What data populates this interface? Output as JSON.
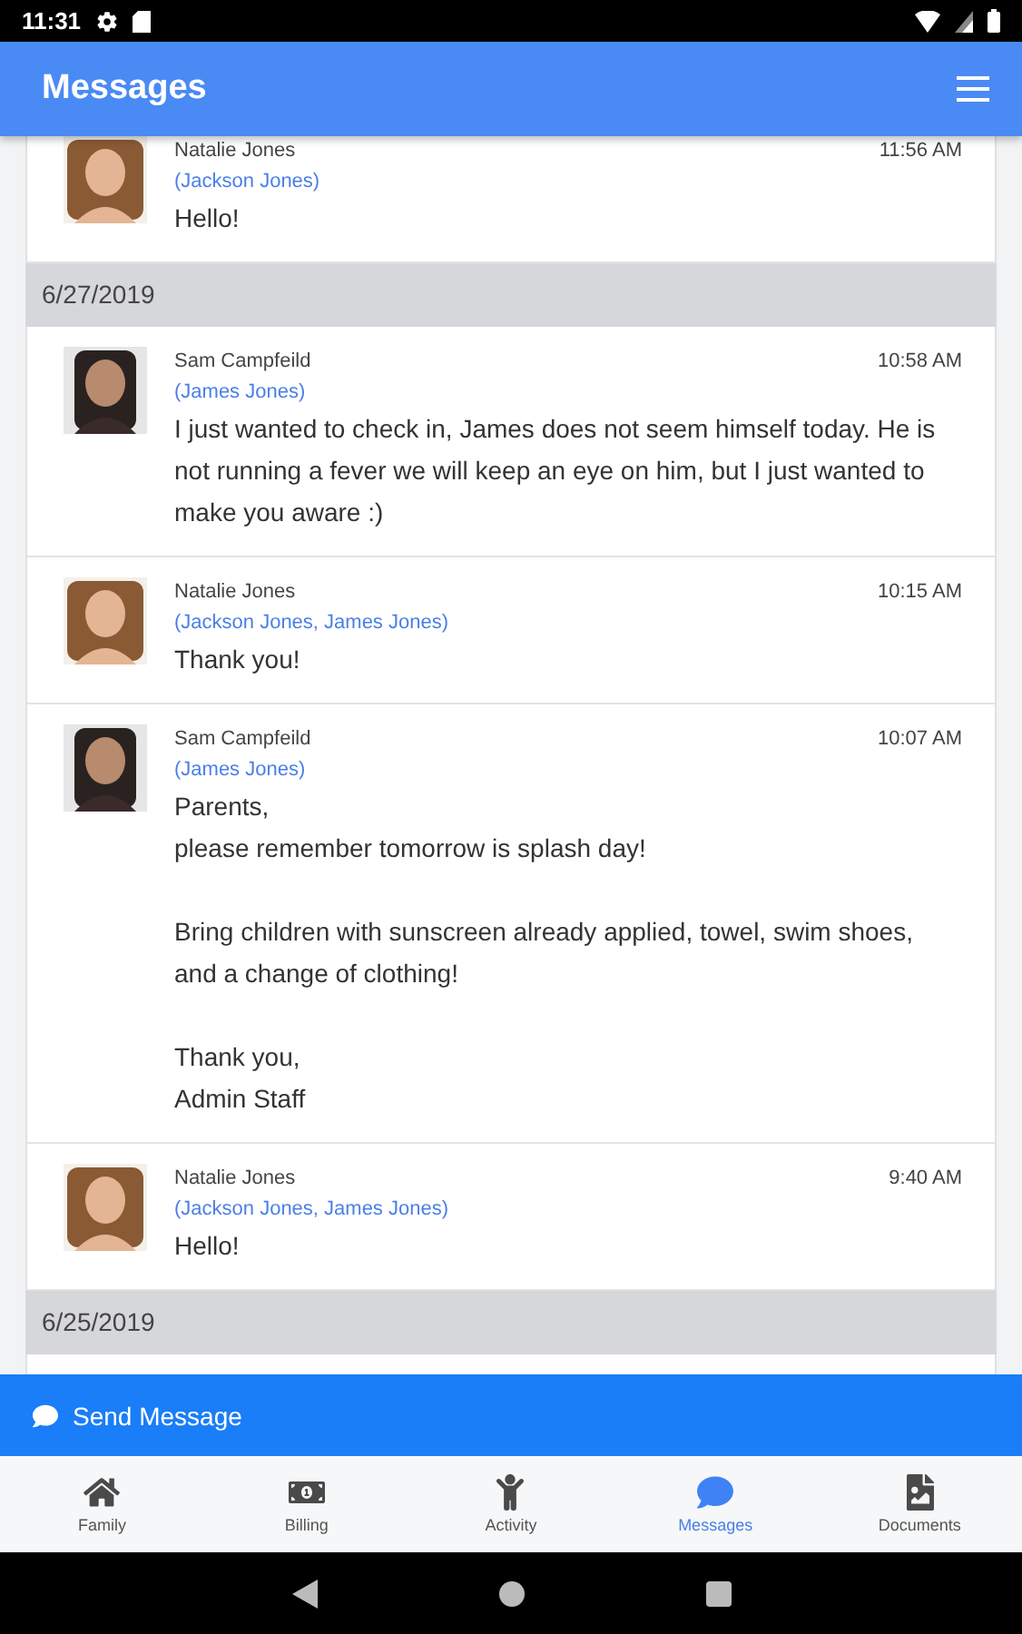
{
  "status_bar": {
    "time": "11:31"
  },
  "header": {
    "title": "Messages"
  },
  "feed": [
    {
      "kind": "message",
      "sender": "Natalie Jones",
      "recipients": "(Jackson Jones)",
      "time": "11:56 AM",
      "body": "Hello!"
    },
    {
      "kind": "date",
      "label": "6/27/2019"
    },
    {
      "kind": "message",
      "sender": "Sam Campfeild",
      "recipients": "(James Jones)",
      "time": "10:58 AM",
      "body": "I just wanted to check in, James does not seem himself today. He is not running a fever we will keep an eye on him, but I just wanted to make you aware :)"
    },
    {
      "kind": "message",
      "sender": "Natalie Jones",
      "recipients": "(Jackson Jones, James Jones)",
      "time": "10:15 AM",
      "body": "Thank you!"
    },
    {
      "kind": "message",
      "sender": "Sam Campfeild",
      "recipients": "(James Jones)",
      "time": "10:07 AM",
      "body": "Parents,\nplease remember tomorrow is splash day!\n\nBring children with sunscreen already applied, towel, swim shoes, and a change of clothing!\n\nThank you,\nAdmin Staff"
    },
    {
      "kind": "message",
      "sender": "Natalie Jones",
      "recipients": "(Jackson Jones, James Jones)",
      "time": "9:40 AM",
      "body": "Hello!"
    },
    {
      "kind": "date",
      "label": "6/25/2019"
    }
  ],
  "send_button": {
    "label": "Send Message"
  },
  "tabs": [
    {
      "label": "Family",
      "selected": false
    },
    {
      "label": "Billing",
      "selected": false
    },
    {
      "label": "Activity",
      "selected": false
    },
    {
      "label": "Messages",
      "selected": true
    },
    {
      "label": "Documents",
      "selected": false
    }
  ]
}
